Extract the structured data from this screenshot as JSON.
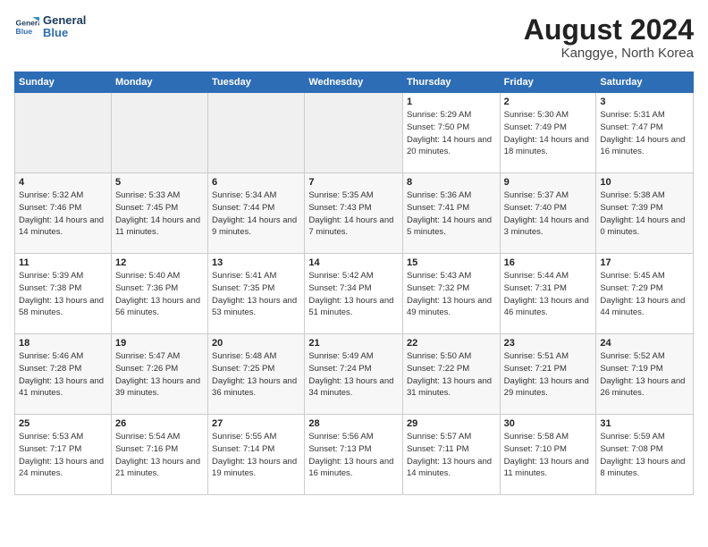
{
  "header": {
    "logo_line1": "General",
    "logo_line2": "Blue",
    "title": "August 2024",
    "subtitle": "Kanggye, North Korea"
  },
  "days_of_week": [
    "Sunday",
    "Monday",
    "Tuesday",
    "Wednesday",
    "Thursday",
    "Friday",
    "Saturday"
  ],
  "weeks": [
    [
      {
        "day": "",
        "empty": true
      },
      {
        "day": "",
        "empty": true
      },
      {
        "day": "",
        "empty": true
      },
      {
        "day": "",
        "empty": true
      },
      {
        "day": "1",
        "sunrise": "5:29 AM",
        "sunset": "7:50 PM",
        "daylight": "14 hours and 20 minutes."
      },
      {
        "day": "2",
        "sunrise": "5:30 AM",
        "sunset": "7:49 PM",
        "daylight": "14 hours and 18 minutes."
      },
      {
        "day": "3",
        "sunrise": "5:31 AM",
        "sunset": "7:47 PM",
        "daylight": "14 hours and 16 minutes."
      }
    ],
    [
      {
        "day": "4",
        "sunrise": "5:32 AM",
        "sunset": "7:46 PM",
        "daylight": "14 hours and 14 minutes."
      },
      {
        "day": "5",
        "sunrise": "5:33 AM",
        "sunset": "7:45 PM",
        "daylight": "14 hours and 11 minutes."
      },
      {
        "day": "6",
        "sunrise": "5:34 AM",
        "sunset": "7:44 PM",
        "daylight": "14 hours and 9 minutes."
      },
      {
        "day": "7",
        "sunrise": "5:35 AM",
        "sunset": "7:43 PM",
        "daylight": "14 hours and 7 minutes."
      },
      {
        "day": "8",
        "sunrise": "5:36 AM",
        "sunset": "7:41 PM",
        "daylight": "14 hours and 5 minutes."
      },
      {
        "day": "9",
        "sunrise": "5:37 AM",
        "sunset": "7:40 PM",
        "daylight": "14 hours and 3 minutes."
      },
      {
        "day": "10",
        "sunrise": "5:38 AM",
        "sunset": "7:39 PM",
        "daylight": "14 hours and 0 minutes."
      }
    ],
    [
      {
        "day": "11",
        "sunrise": "5:39 AM",
        "sunset": "7:38 PM",
        "daylight": "13 hours and 58 minutes."
      },
      {
        "day": "12",
        "sunrise": "5:40 AM",
        "sunset": "7:36 PM",
        "daylight": "13 hours and 56 minutes."
      },
      {
        "day": "13",
        "sunrise": "5:41 AM",
        "sunset": "7:35 PM",
        "daylight": "13 hours and 53 minutes."
      },
      {
        "day": "14",
        "sunrise": "5:42 AM",
        "sunset": "7:34 PM",
        "daylight": "13 hours and 51 minutes."
      },
      {
        "day": "15",
        "sunrise": "5:43 AM",
        "sunset": "7:32 PM",
        "daylight": "13 hours and 49 minutes."
      },
      {
        "day": "16",
        "sunrise": "5:44 AM",
        "sunset": "7:31 PM",
        "daylight": "13 hours and 46 minutes."
      },
      {
        "day": "17",
        "sunrise": "5:45 AM",
        "sunset": "7:29 PM",
        "daylight": "13 hours and 44 minutes."
      }
    ],
    [
      {
        "day": "18",
        "sunrise": "5:46 AM",
        "sunset": "7:28 PM",
        "daylight": "13 hours and 41 minutes."
      },
      {
        "day": "19",
        "sunrise": "5:47 AM",
        "sunset": "7:26 PM",
        "daylight": "13 hours and 39 minutes."
      },
      {
        "day": "20",
        "sunrise": "5:48 AM",
        "sunset": "7:25 PM",
        "daylight": "13 hours and 36 minutes."
      },
      {
        "day": "21",
        "sunrise": "5:49 AM",
        "sunset": "7:24 PM",
        "daylight": "13 hours and 34 minutes."
      },
      {
        "day": "22",
        "sunrise": "5:50 AM",
        "sunset": "7:22 PM",
        "daylight": "13 hours and 31 minutes."
      },
      {
        "day": "23",
        "sunrise": "5:51 AM",
        "sunset": "7:21 PM",
        "daylight": "13 hours and 29 minutes."
      },
      {
        "day": "24",
        "sunrise": "5:52 AM",
        "sunset": "7:19 PM",
        "daylight": "13 hours and 26 minutes."
      }
    ],
    [
      {
        "day": "25",
        "sunrise": "5:53 AM",
        "sunset": "7:17 PM",
        "daylight": "13 hours and 24 minutes."
      },
      {
        "day": "26",
        "sunrise": "5:54 AM",
        "sunset": "7:16 PM",
        "daylight": "13 hours and 21 minutes."
      },
      {
        "day": "27",
        "sunrise": "5:55 AM",
        "sunset": "7:14 PM",
        "daylight": "13 hours and 19 minutes."
      },
      {
        "day": "28",
        "sunrise": "5:56 AM",
        "sunset": "7:13 PM",
        "daylight": "13 hours and 16 minutes."
      },
      {
        "day": "29",
        "sunrise": "5:57 AM",
        "sunset": "7:11 PM",
        "daylight": "13 hours and 14 minutes."
      },
      {
        "day": "30",
        "sunrise": "5:58 AM",
        "sunset": "7:10 PM",
        "daylight": "13 hours and 11 minutes."
      },
      {
        "day": "31",
        "sunrise": "5:59 AM",
        "sunset": "7:08 PM",
        "daylight": "13 hours and 8 minutes."
      }
    ]
  ],
  "labels": {
    "sunrise": "Sunrise:",
    "sunset": "Sunset:",
    "daylight": "Daylight:"
  }
}
